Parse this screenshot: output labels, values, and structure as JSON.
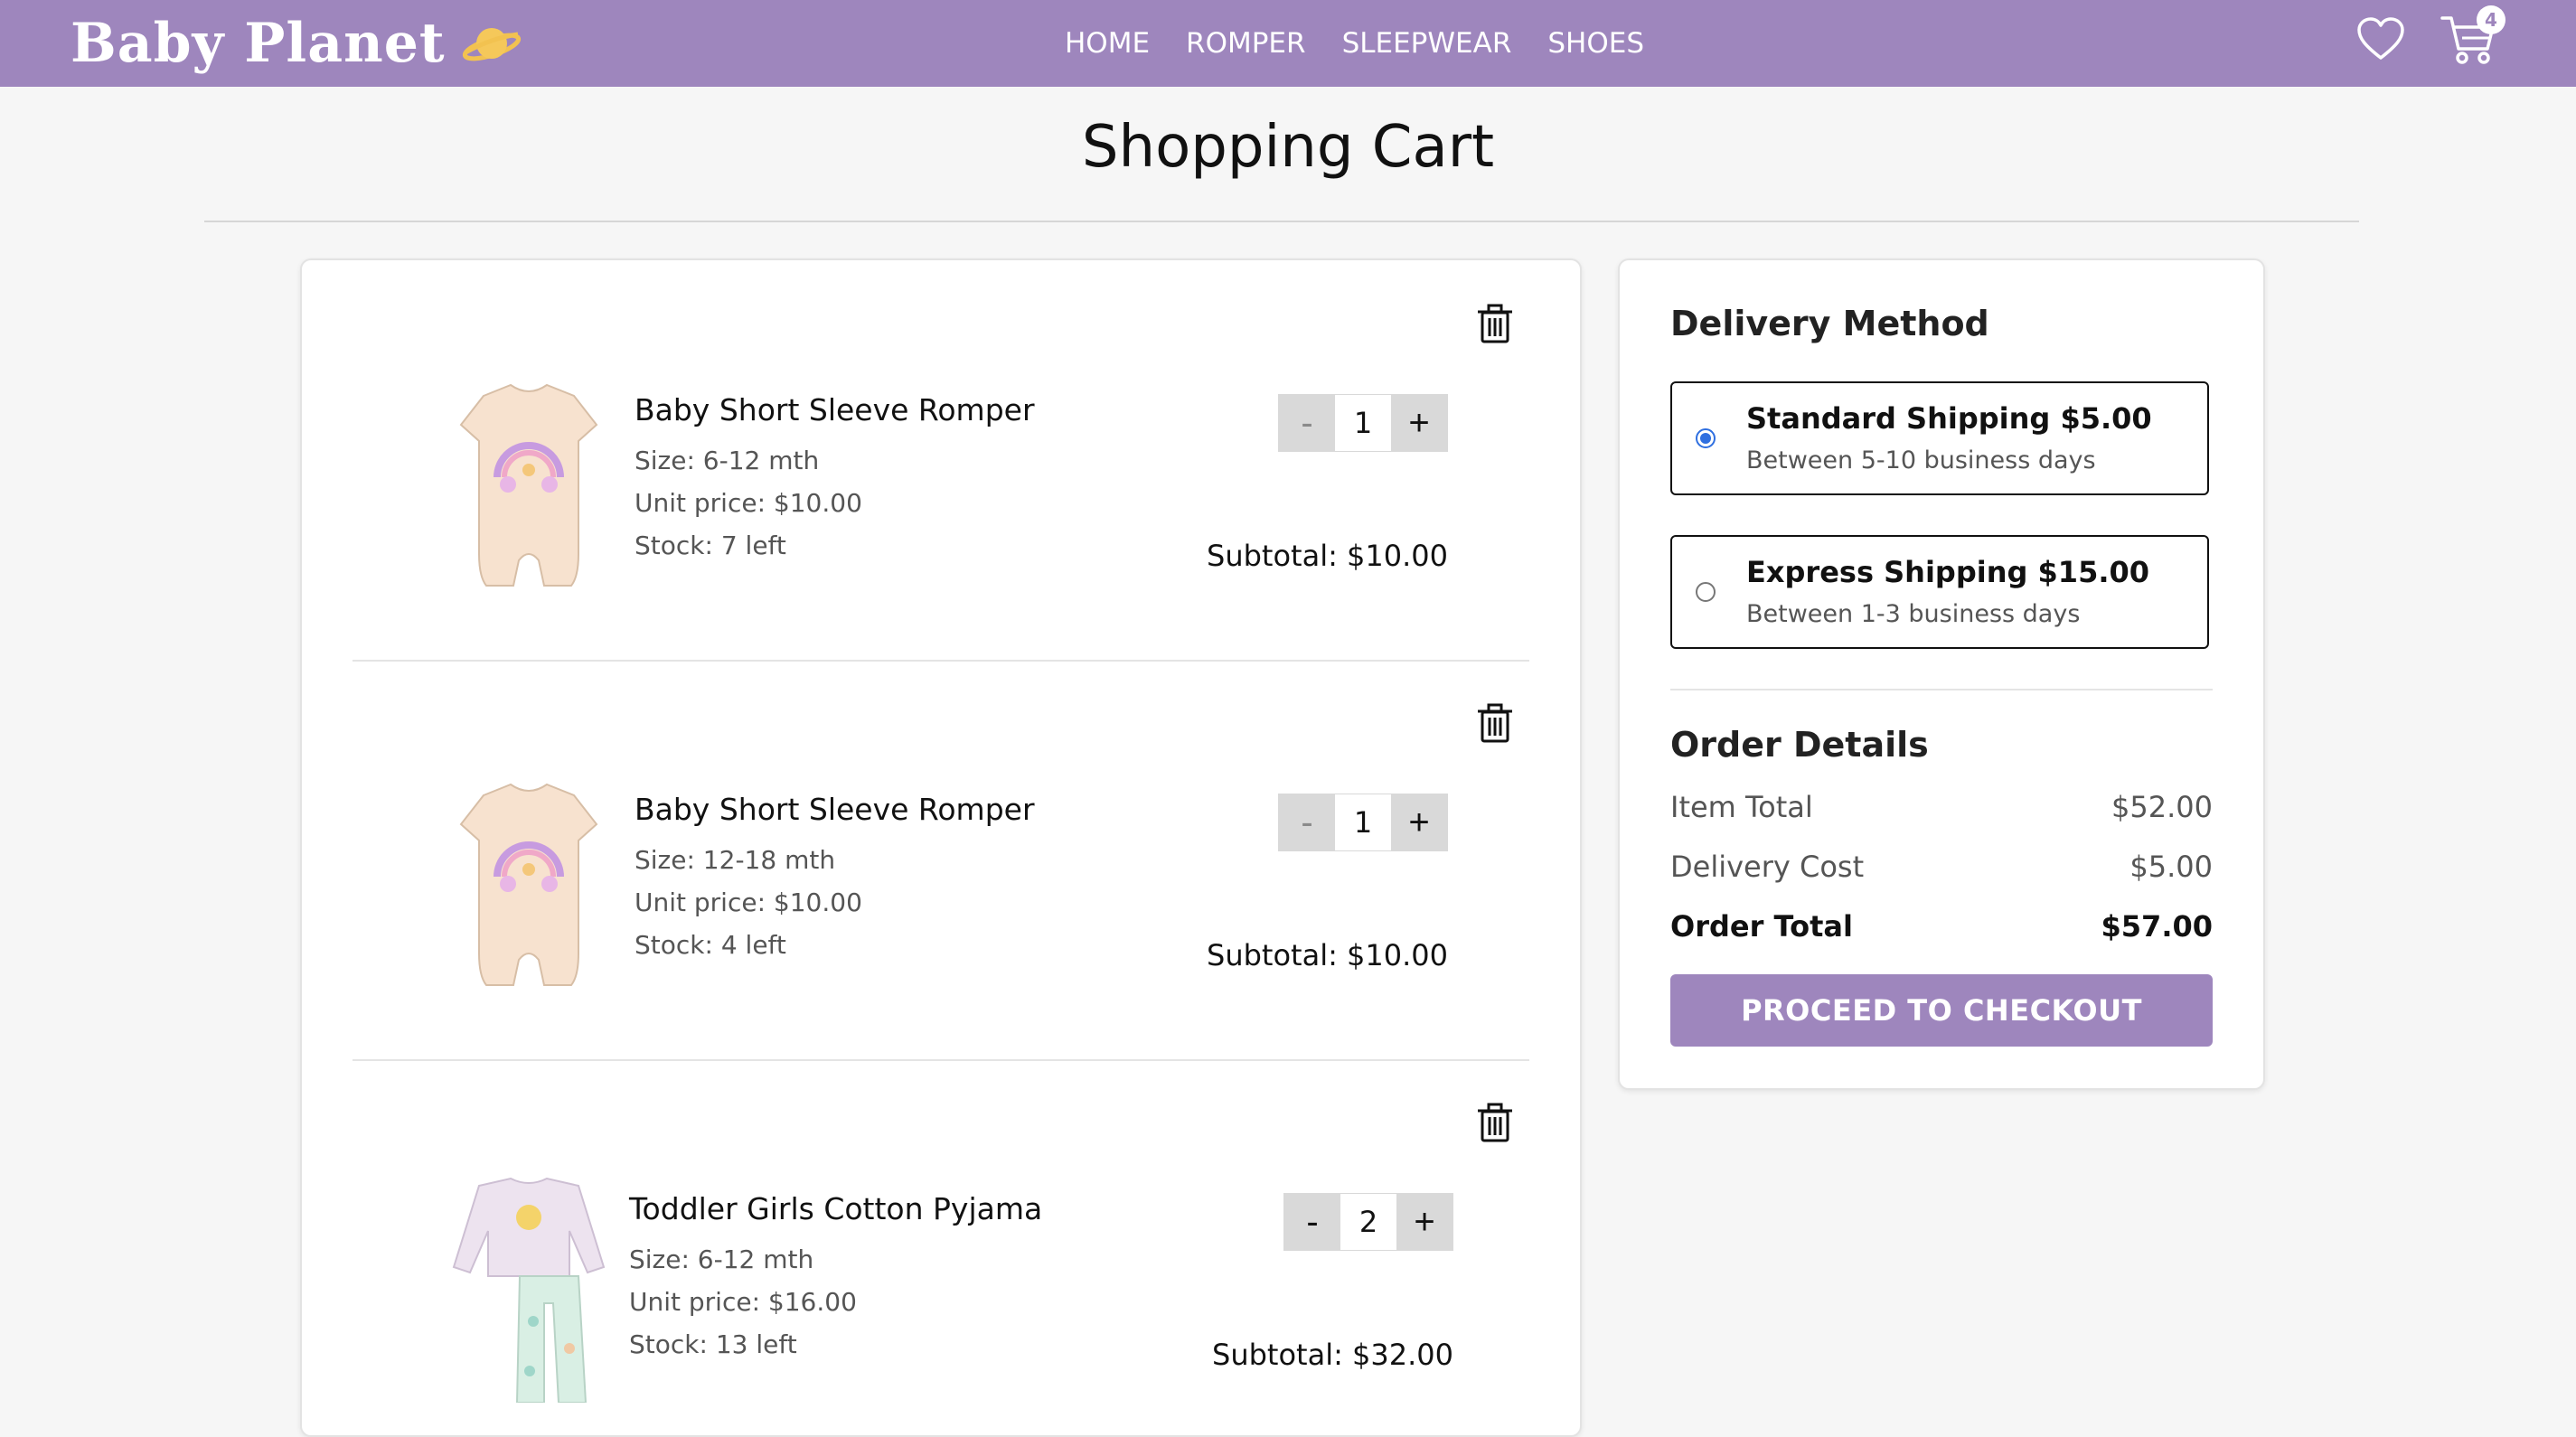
{
  "navbar": {
    "brand": "Baby Planet",
    "links": [
      "HOME",
      "ROMPER",
      "SLEEPWEAR",
      "SHOES"
    ],
    "cart_count": "4",
    "color": "#9e86bd"
  },
  "page_title": "Shopping Cart",
  "cart": {
    "items": [
      {
        "name": "Baby Short Sleeve Romper",
        "size": "Size: 6-12 mth",
        "unit_price": "Unit price: $10.00",
        "stock": "Stock: 7 left",
        "quantity": "1",
        "minus": "-",
        "plus": "+",
        "subtotal": "Subtotal: $10.00",
        "image": "romper-icon"
      },
      {
        "name": "Baby Short Sleeve Romper",
        "size": "Size: 12-18 mth",
        "unit_price": "Unit price: $10.00",
        "stock": "Stock: 4 left",
        "quantity": "1",
        "minus": "-",
        "plus": "+",
        "subtotal": "Subtotal: $10.00",
        "image": "romper-icon"
      },
      {
        "name": "Toddler Girls Cotton Pyjama",
        "size": "Size: 6-12 mth",
        "unit_price": "Unit price: $16.00",
        "stock": "Stock: 13 left",
        "quantity": "2",
        "minus": "-",
        "plus": "+",
        "subtotal": "Subtotal: $32.00",
        "image": "pyjama-icon"
      }
    ]
  },
  "summary": {
    "delivery_heading": "Delivery Method",
    "shipping_options": [
      {
        "title": "Standard Shipping $5.00",
        "subtitle": "Between 5-10 business days",
        "selected": true
      },
      {
        "title": "Express Shipping $15.00",
        "subtitle": "Between 1-3 business days",
        "selected": false
      }
    ],
    "order_heading": "Order Details",
    "rows": [
      {
        "label": "Item Total",
        "value": "$52.00"
      },
      {
        "label": "Delivery Cost",
        "value": "$5.00"
      },
      {
        "label": "Order Total",
        "value": "$57.00"
      }
    ],
    "checkout_label": "PROCEED TO CHECKOUT"
  }
}
